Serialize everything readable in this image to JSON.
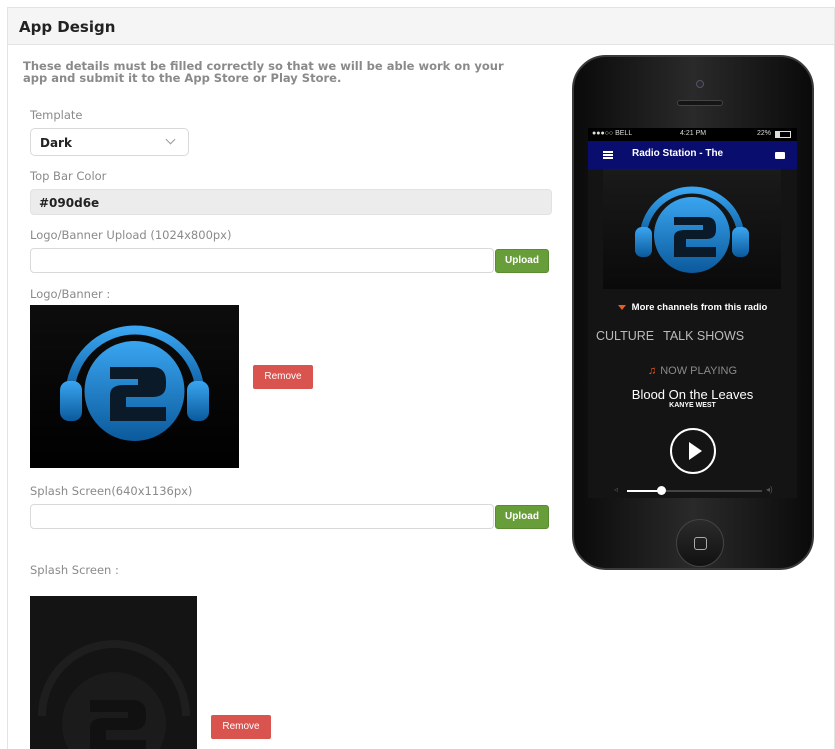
{
  "panel": {
    "title": "App Design"
  },
  "intro": "These details must be filled correctly so that we will be able work on your app and submit it to the App Store or Play Store.",
  "template": {
    "label": "Template",
    "value": "Dark"
  },
  "top_bar_color": {
    "label": "Top Bar Color",
    "value": "#090d6e"
  },
  "logo_upload": {
    "label": "Logo/Banner Upload (1024x800px)",
    "value": "",
    "button": "Upload"
  },
  "logo_preview": {
    "label": "Logo/Banner :",
    "remove": "Remove"
  },
  "splash_upload": {
    "label": "Splash Screen(640x1136px)",
    "value": "",
    "button": "Upload"
  },
  "splash_preview": {
    "label": "Splash Screen :",
    "remove": "Remove"
  },
  "phone": {
    "carrier": "●●●○○ BELL",
    "time": "4:21 PM",
    "battery": "22%",
    "top_bar_title": "Radio Station - The",
    "more_channels": "More channels from this radio",
    "categories": [
      "CULTURE",
      "TALK SHOWS"
    ],
    "now_playing": "NOW PLAYING",
    "song": "Blood On the Leaves",
    "artist": "KANYE WEST",
    "volume_level": 0.25
  },
  "colors": {
    "upload_button": "#689e3a",
    "remove_button": "#d9534f",
    "accent_orange": "#e85d23",
    "logo_blue": "#1d8bd8"
  },
  "icons": {
    "chevron": "chevron-down-icon",
    "menu": "hamburger-icon",
    "chat": "chat-icon",
    "play": "play-icon",
    "headphones": "headphones-logo"
  }
}
